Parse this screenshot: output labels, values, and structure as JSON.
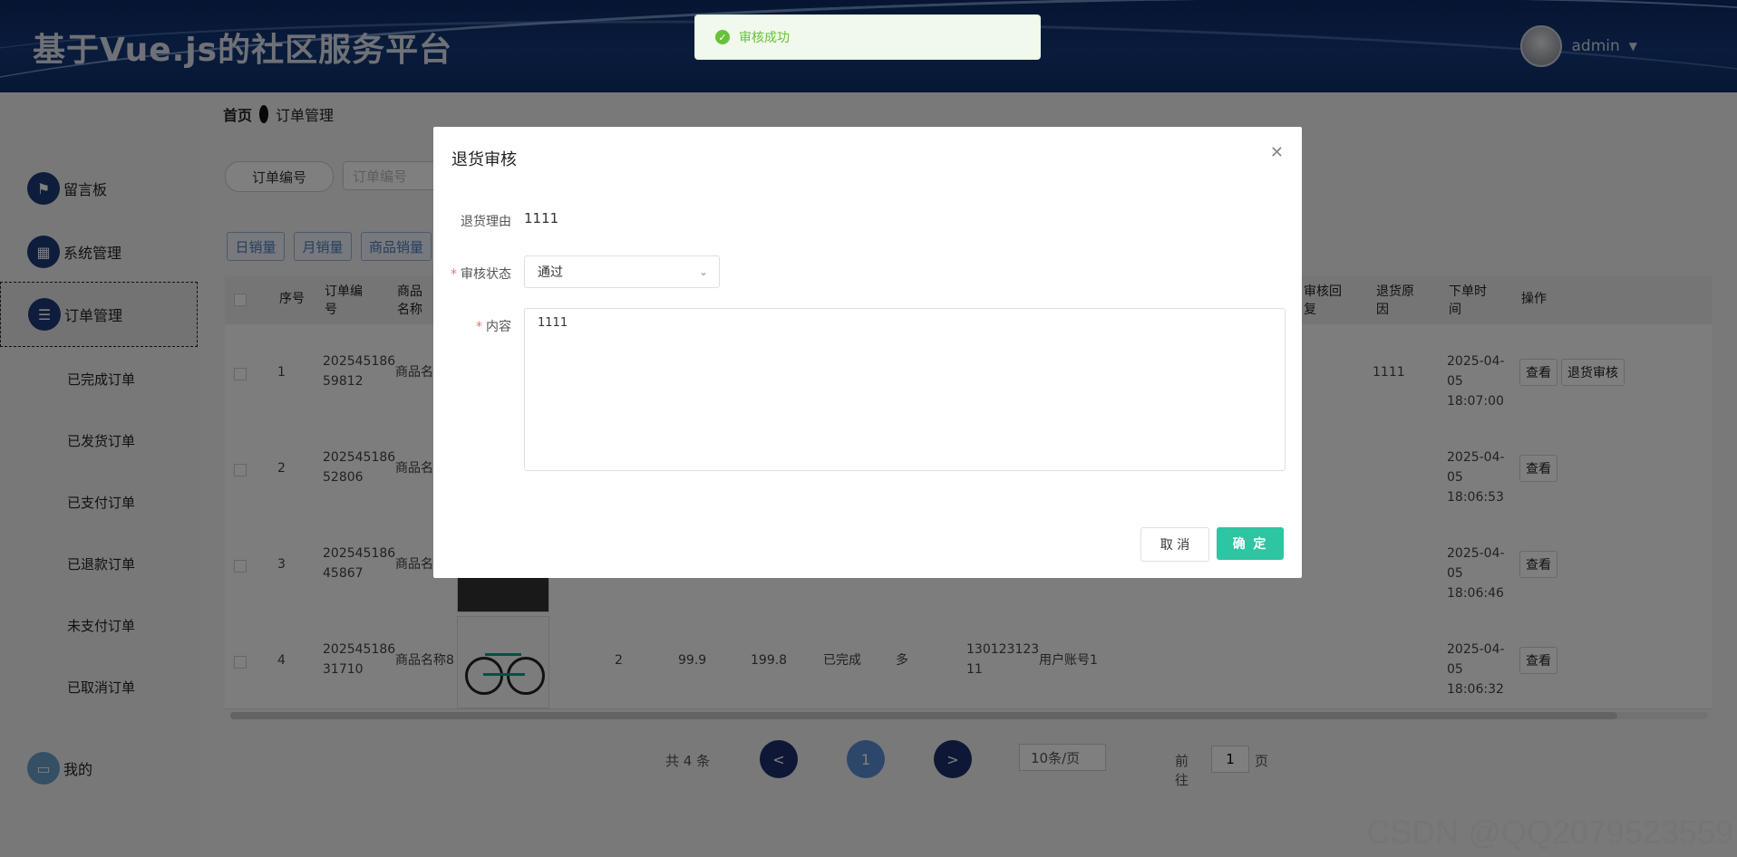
{
  "header": {
    "title": "基于Vue.js的社区服务平台",
    "username": "admin",
    "caret": "▼"
  },
  "breadcrumb": {
    "home": "首页",
    "current": "订单管理"
  },
  "sidebar": {
    "items": [
      {
        "label": "留言板",
        "icon": "flag-icon",
        "glyph": "⚑"
      },
      {
        "label": "系统管理",
        "icon": "grid-icon",
        "glyph": "▦"
      },
      {
        "label": "订单管理",
        "icon": "sliders-icon",
        "glyph": "☰"
      },
      {
        "label": "我的",
        "icon": "card-icon",
        "glyph": "▭"
      }
    ],
    "sub_items": [
      "已完成订单",
      "已发货订单",
      "已支付订单",
      "已退款订单",
      "未支付订单",
      "已取消订单"
    ]
  },
  "search": {
    "label": "订单编号",
    "placeholder": "订单编号"
  },
  "stat_buttons": [
    "日销量",
    "月销量",
    "商品销量"
  ],
  "table": {
    "headers": [
      "序号",
      "订单编号",
      "商品名称",
      "审核回复",
      "退货原因",
      "下单时间",
      "操作"
    ],
    "rows": [
      {
        "index": "1",
        "order_no": "202545186 59812",
        "product": "商品名",
        "reason": "1111",
        "time": "2025-04-05 18:07:00",
        "actions": [
          "查看",
          "退货审核"
        ]
      },
      {
        "index": "2",
        "order_no": "202545186 52806",
        "product": "商品名",
        "reason": "",
        "time": "2025-04-05 18:06:53",
        "actions": [
          "查看"
        ]
      },
      {
        "index": "3",
        "order_no": "202545186 45867",
        "product": "商品名",
        "reason": "",
        "time": "2025-04-05 18:06:46",
        "actions": [
          "查看"
        ]
      },
      {
        "index": "4",
        "order_no": "202545186 31710",
        "product": "商品名称8",
        "qty": "2",
        "price": "99.9",
        "total": "199.8",
        "status": "已完成",
        "addr": "多",
        "phone": "130123123 11",
        "account": "用户账号1",
        "reason": "",
        "time": "2025-04-05 18:06:32",
        "actions": [
          "查看"
        ]
      }
    ]
  },
  "pager": {
    "total": "共 4 条",
    "prev": "<",
    "page": "1",
    "next": ">",
    "size": "10条/页",
    "goto_label": "前往",
    "goto_value": "1",
    "goto_unit": "页"
  },
  "dialog": {
    "title": "退货审核",
    "reason_label": "退货理由",
    "reason_value": "1111",
    "status_label": "审核状态",
    "status_value": "通过",
    "content_label": "内容",
    "content_value": "1111",
    "cancel": "取 消",
    "ok": "确 定"
  },
  "toast": {
    "text": "审核成功",
    "color": "#67c23a"
  },
  "watermark": "CSDN @QQ2079523559",
  "colors": {
    "header": "#133878",
    "accent": "#2dc5a2",
    "nav_icon": "#1e3a78"
  }
}
